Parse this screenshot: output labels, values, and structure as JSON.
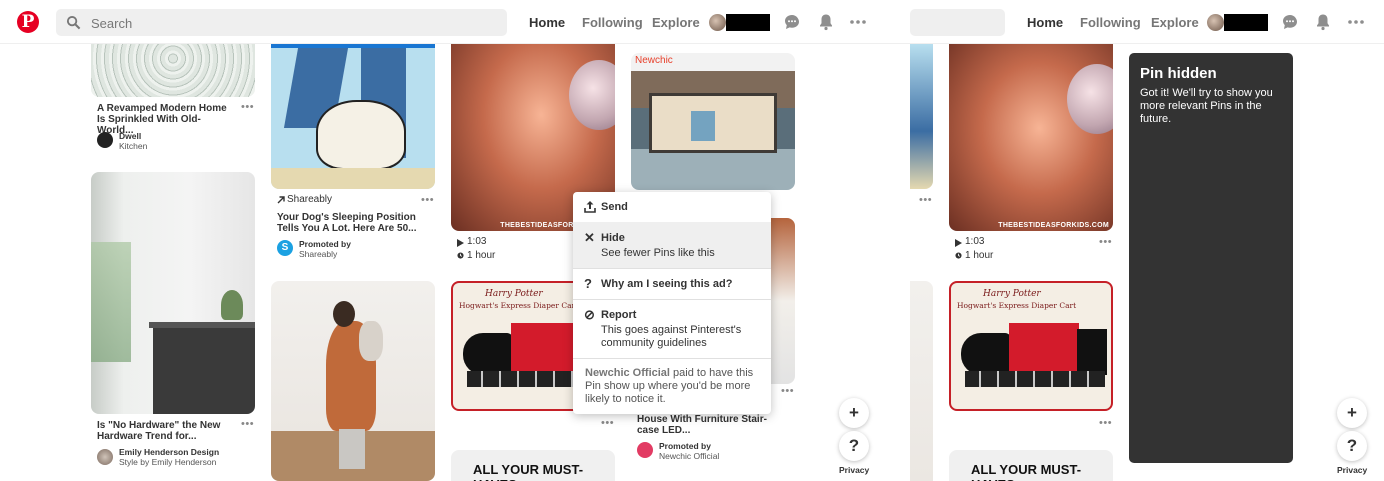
{
  "header": {
    "logo": "P",
    "search_placeholder": "Search",
    "nav": {
      "home": "Home",
      "following": "Following",
      "explore": "Explore"
    },
    "icons": [
      "search-icon",
      "messages-icon",
      "notifications-icon",
      "more-icon"
    ]
  },
  "pins": {
    "home_pin": {
      "title": "A Revamped Modern Home Is Sprinkled With Old-World...",
      "source": "Dwell",
      "board": "Kitchen"
    },
    "dog_pin": {
      "attribution": "Shareably",
      "title": "Your Dog's Sleeping Position Tells You A Lot. Here Are 50...",
      "promoted": "Promoted by",
      "promoter": "Shareably"
    },
    "gummy_pin": {
      "duration": "1:03",
      "ago": "1 hour",
      "watermark": "THEBESTIDEASFORKIDS.COM"
    },
    "kitchen_pin": {
      "title": "Is \"No Hardware\" the New Hardware Trend for...",
      "author": "Emily Henderson Design",
      "board": "Style by Emily Henderson"
    },
    "train_pin": {
      "header": "Harry Potter",
      "subheader": "Hogwart's Express Diaper Cart"
    },
    "house_pin": {
      "brand": "Newchic",
      "title": "House With Furniture Stair-case LED...",
      "promoted": "Promoted by",
      "promoter": "Newchic Official"
    },
    "musthave_pin": {
      "text": "ALL YOUR MUST-HAVES"
    }
  },
  "menu": {
    "send": "Send",
    "hide": "Hide",
    "hide_desc": "See fewer Pins like this",
    "why": "Why am I seeing this ad?",
    "report": "Report",
    "report_desc": "This goes against Pinterest's community guidelines",
    "ad_advertiser": "Newchic Official",
    "ad_text": " paid to have this Pin show up where you'd be more likely to notice it."
  },
  "hidden_card": {
    "title": "Pin hidden",
    "body": "Got it! We'll try to show you more relevant Pins in the future."
  },
  "floating": {
    "add": "+",
    "help": "?",
    "privacy": "Privacy"
  },
  "colors": {
    "brand": "#e60023",
    "hidden_bg": "#333333"
  }
}
